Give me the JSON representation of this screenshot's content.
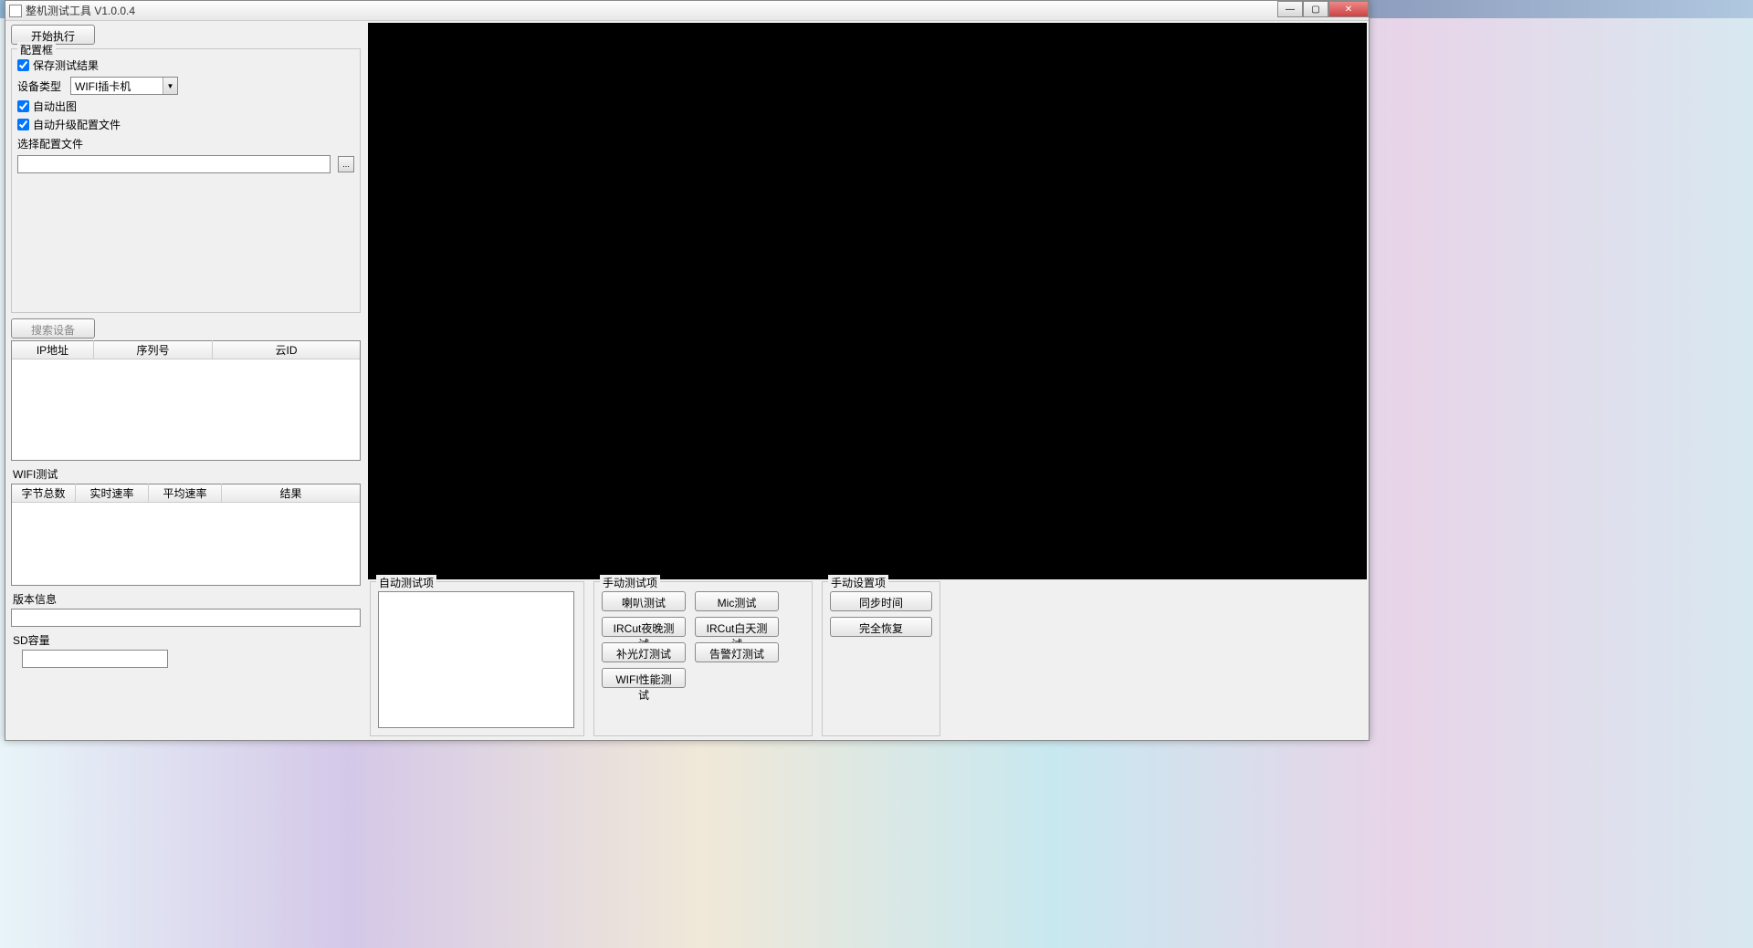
{
  "window": {
    "title": "整机测试工具 V1.0.0.4"
  },
  "left": {
    "start_button": "开始执行",
    "config_group": "配置框",
    "save_result": "保存测试结果",
    "device_type_label": "设备类型",
    "device_type_value": "WIFI插卡机",
    "auto_img": "自动出图",
    "auto_upgrade": "自动升级配置文件",
    "select_config": "选择配置文件",
    "browse": "...",
    "search_device": "搜索设备",
    "device_table": {
      "col_ip": "IP地址",
      "col_sn": "序列号",
      "col_cloud": "云ID"
    },
    "wifi_test": "WIFI测试",
    "wifi_table": {
      "col_bytes": "字节总数",
      "col_rt": "实时速率",
      "col_avg": "平均速率",
      "col_result": "结果"
    },
    "version_info": "版本信息",
    "sd_capacity": "SD容量"
  },
  "bottom": {
    "auto_group": "自动测试项",
    "manual_group": "手动测试项",
    "settings_group": "手动设置项",
    "manual_buttons": {
      "speaker": "喇叭测试",
      "mic": "Mic测试",
      "ircut_night": "IRCut夜晚测试",
      "ircut_day": "IRCut白天测试",
      "fill_light": "补光灯测试",
      "alarm_light": "告警灯测试",
      "wifi_perf": "WIFI性能测试"
    },
    "settings_buttons": {
      "sync_time": "同步时间",
      "full_restore": "完全恢复"
    }
  }
}
